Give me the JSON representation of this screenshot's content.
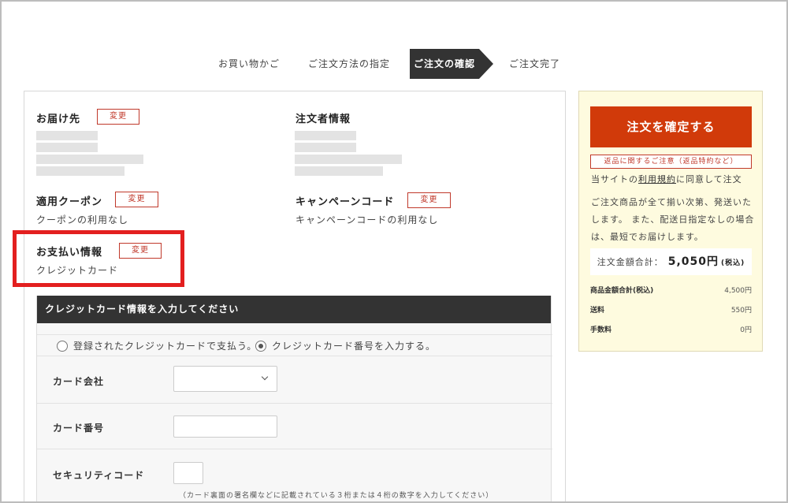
{
  "steps": [
    "お買い物かご",
    "ご注文方法の指定",
    "ご注文の確認",
    "ご注文完了"
  ],
  "delivery": {
    "title": "お届け先",
    "change_label": "変更"
  },
  "orderer": {
    "title": "注文者情報"
  },
  "coupon": {
    "title": "適用クーポン",
    "change_label": "変更",
    "value": "クーポンの利用なし"
  },
  "campaign": {
    "title": "キャンペーンコード",
    "change_label": "変更",
    "value": "キャンペーンコードの利用なし"
  },
  "payment": {
    "title": "お支払い情報",
    "change_label": "変更",
    "value": "クレジットカード"
  },
  "credit_card": {
    "header": "クレジットカード情報を入力してください",
    "option_registered": "登録されたクレジットカードで支払う。",
    "option_new": "クレジットカード番号を入力する。",
    "company_label": "カード会社",
    "company_value": "",
    "number_label": "カード番号",
    "number_value": "",
    "security_label": "セキュリティコード",
    "security_value": "",
    "security_hint": "（カード裏面の署名欄などに記載されている３桁または４桁の数字を入力してください）"
  },
  "sidebar": {
    "confirm_label": "注文を確定する",
    "return_notice": "返品に関するご注意（返品特約など）",
    "agree_pre": "当サイトの",
    "agree_link": "利用規約",
    "agree_post": "に同意して注文",
    "shipping_notice": "ご注文商品が全て揃い次第、発送いたします。 また、配送日指定なしの場合は、最短でお届けします。",
    "total_label": "注文金額合計：",
    "total_amount": "5,050円",
    "total_tax": "(税込)",
    "breakdown": [
      {
        "label": "商品金額合計(税込)",
        "value": "4,500円"
      },
      {
        "label": "送料",
        "value": "550円"
      },
      {
        "label": "手数料",
        "value": "0円"
      }
    ]
  },
  "colors": {
    "accent": "#d13a0a",
    "highlight": "#e31f1f",
    "dark": "#333333",
    "sidebar_bg": "#fefbdf"
  }
}
